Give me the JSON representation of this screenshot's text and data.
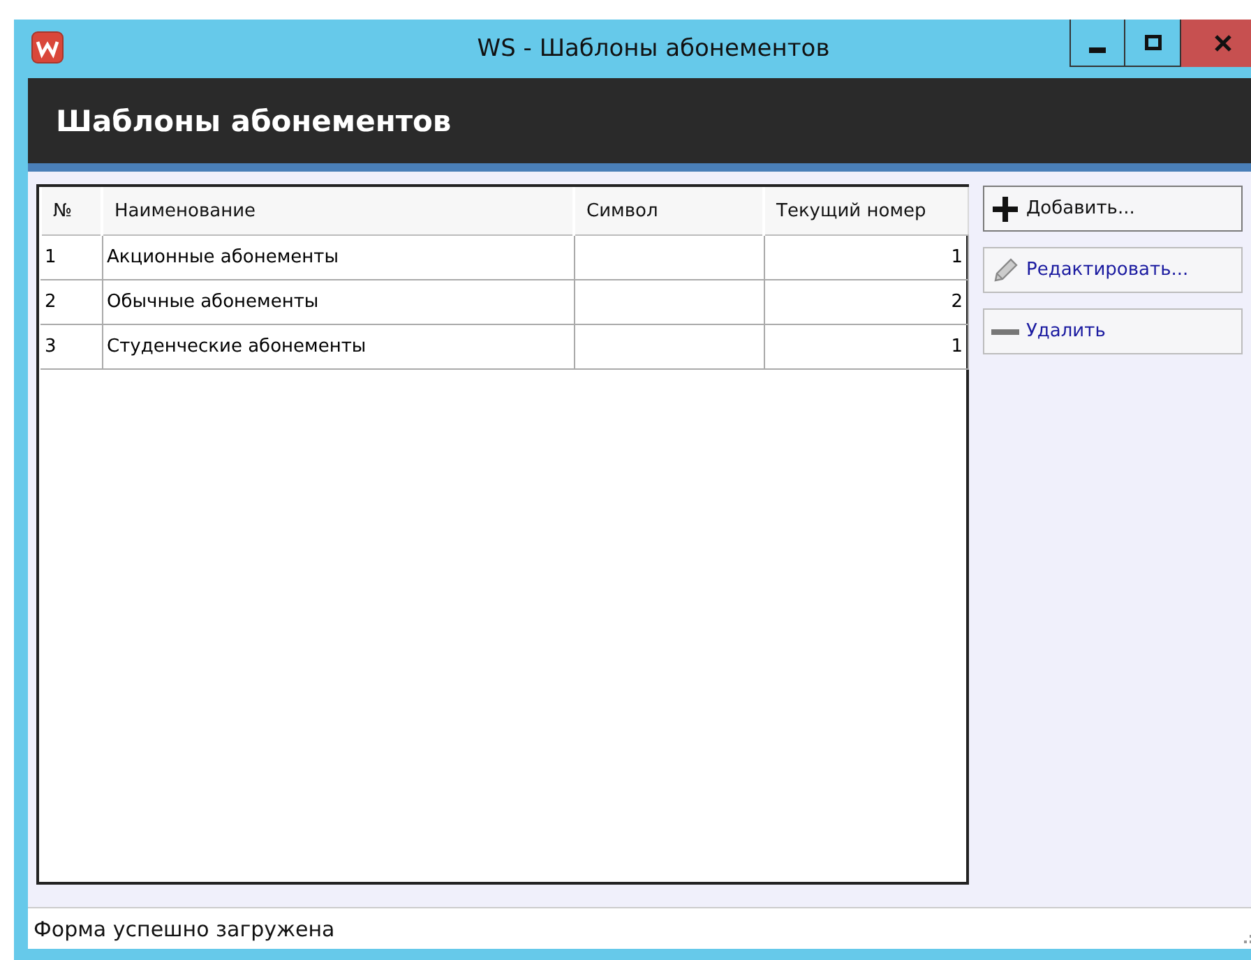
{
  "window": {
    "title": "WS - Шаблоны абонементов",
    "controls": [
      {
        "kind": "minimize"
      },
      {
        "kind": "maximize"
      },
      {
        "kind": "close"
      }
    ]
  },
  "header": {
    "title": "Шаблоны абонементов"
  },
  "table": {
    "columns": [
      "№",
      "Наименование",
      "Символ",
      "Текущий номер"
    ],
    "rows": [
      {
        "cells": [
          "1",
          "Акционные абонементы",
          "",
          "1"
        ]
      },
      {
        "cells": [
          "2",
          "Обычные абонементы",
          "",
          "2"
        ]
      },
      {
        "cells": [
          "3",
          "Студенческие абонементы",
          "",
          "1"
        ]
      }
    ]
  },
  "actions": [
    {
      "label": "Добавить...",
      "kind": "add",
      "focused": true
    },
    {
      "label": "Редактировать...",
      "kind": "edit",
      "focused": false
    },
    {
      "label": "Удалить",
      "kind": "delete",
      "focused": false
    }
  ],
  "status_bar": {
    "text": "Форма успешно загружена"
  }
}
